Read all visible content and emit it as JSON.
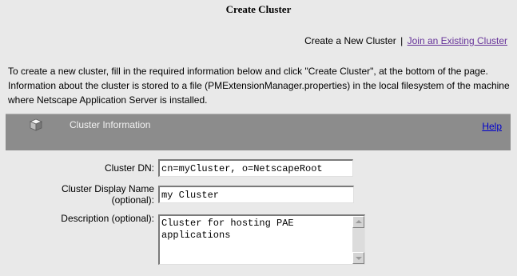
{
  "page": {
    "title": "Create Cluster"
  },
  "subnav": {
    "current": "Create a New Cluster",
    "separator": "|",
    "link": "Join an Existing Cluster"
  },
  "intro": {
    "text": "To create a new cluster, fill in the required information below and click \"Create Cluster\", at the bottom of the page. Information about the cluster is stored to a file (PMExtensionManager.properties) in the local filesystem of the machine where Netscape Application Server is installed."
  },
  "panel": {
    "title": "Cluster Information",
    "help_label": "Help",
    "icon": "cube-icon"
  },
  "form": {
    "cluster_dn": {
      "label": "Cluster DN:",
      "value": "cn=myCluster, o=NetscapeRoot"
    },
    "display_name": {
      "label_line1": "Cluster Display Name",
      "label_line2": "(optional):",
      "value": "my Cluster"
    },
    "description": {
      "label": "Description (optional):",
      "value": "Cluster for hosting PAE applications"
    }
  },
  "colors": {
    "page_bg": "#e9e9e9",
    "panel_header_bg": "#8c8c8c",
    "link_visited": "#663399",
    "link_help": "#0000cc"
  }
}
